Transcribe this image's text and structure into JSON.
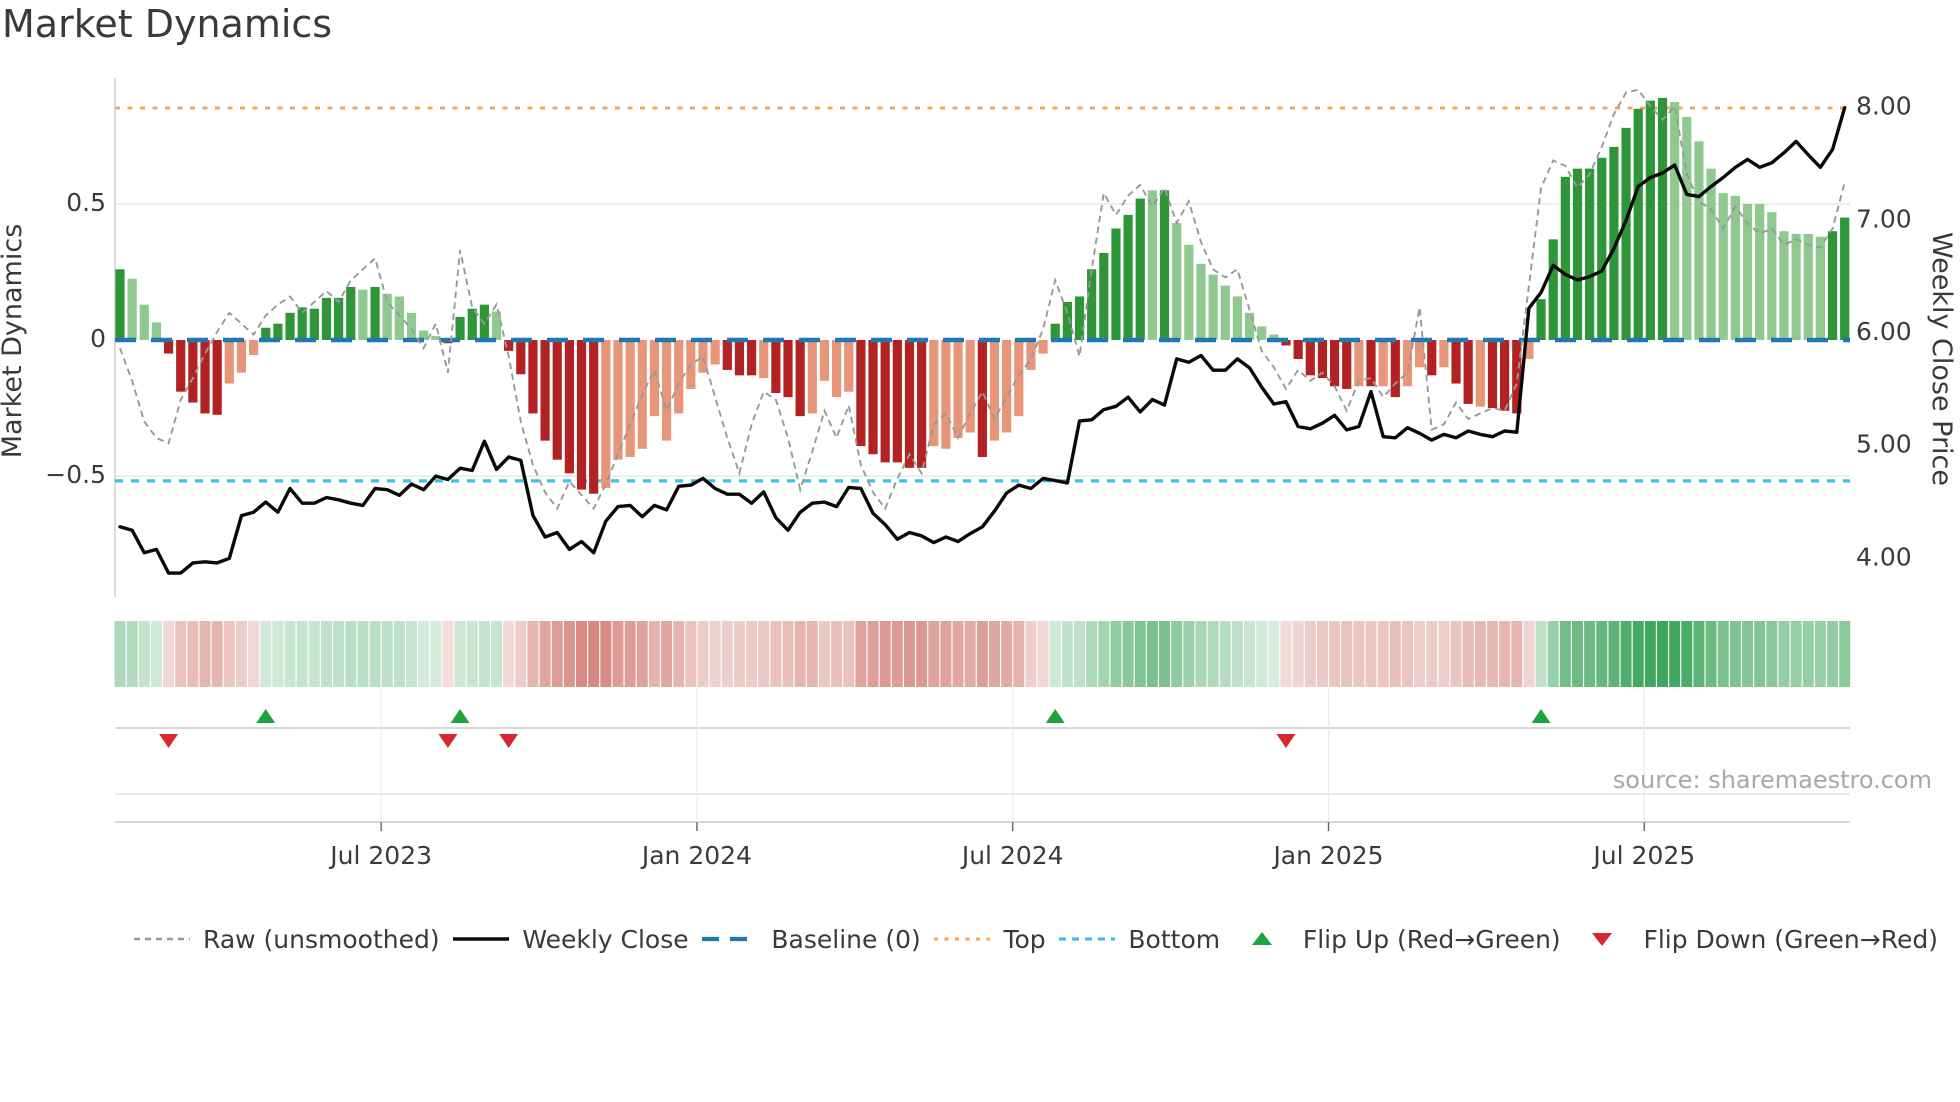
{
  "title": "Market Dynamics",
  "source_text": "source: sharemaestro.com",
  "axes": {
    "left_label": "Market Dynamics",
    "right_label": "Weekly Close Price",
    "left_ticks": [
      {
        "v": 0.5,
        "label": "0.5"
      },
      {
        "v": 0.0,
        "label": "0"
      },
      {
        "v": -0.5,
        "label": "−0.5"
      }
    ],
    "right_ticks": [
      {
        "v": 8.0,
        "label": "8.00"
      },
      {
        "v": 7.0,
        "label": "7.00"
      },
      {
        "v": 6.0,
        "label": "6.00"
      },
      {
        "v": 5.0,
        "label": "5.00"
      },
      {
        "v": 4.0,
        "label": "4.00"
      }
    ],
    "x_ticks": [
      {
        "week": 21.5,
        "label": "Jul 2023"
      },
      {
        "week": 47.5,
        "label": "Jan 2024"
      },
      {
        "week": 73.5,
        "label": "Jul 2024"
      },
      {
        "week": 99.5,
        "label": "Jan 2025"
      },
      {
        "week": 125.5,
        "label": "Jul 2025"
      }
    ]
  },
  "legend": [
    {
      "id": "raw",
      "type": "dash-gray",
      "label": "Raw (unsmoothed)"
    },
    {
      "id": "close",
      "type": "solid-black",
      "label": "Weekly Close"
    },
    {
      "id": "baseline",
      "type": "dash-blue",
      "label": "Baseline (0)"
    },
    {
      "id": "top",
      "type": "dot-orange",
      "label": "Top"
    },
    {
      "id": "bottom",
      "type": "dash-cyan",
      "label": "Bottom"
    },
    {
      "id": "flip-up",
      "type": "triangle-up",
      "label": "Flip Up (Red→Green)"
    },
    {
      "id": "flip-down",
      "type": "triangle-down",
      "label": "Flip Down (Green→Red)"
    }
  ],
  "colors": {
    "strong_green": "#2e9639",
    "weak_green": "#8fc990",
    "strong_red": "#b22222",
    "weak_red": "#e8967a",
    "price_line": "#0a0a0a",
    "raw_line": "#999999",
    "baseline": "#1f77b4",
    "top_line": "#f2a663",
    "bottom_line": "#3ec0ea",
    "grid": "#e9e9e9",
    "spine": "#d0d0d0",
    "panel_line": "#cccccc",
    "axis_bottom": "#c8c8c8",
    "tick_text": "#3b3b3b",
    "flip_up": "#1fa33c",
    "flip_down": "#d7282f",
    "heat_green_base": [
      47,
      158,
      79
    ],
    "heat_red_base": [
      192,
      74,
      62
    ]
  },
  "chart_data": {
    "type": "bar",
    "n_weeks": 143,
    "baseline": 0,
    "top_line_value": 0.853,
    "bottom_line_value": -0.518,
    "ylim_left": [
      -0.95,
      0.963
    ],
    "ylim_right": [
      3.66,
      8.26
    ],
    "legend_position": "bottom",
    "grid": "horizontal-light",
    "flip_up_weeks": [
      12,
      28,
      77,
      117
    ],
    "flip_down_weeks": [
      4,
      27,
      32,
      96
    ],
    "osc_values": [
      0.26,
      0.225,
      0.13,
      0.065,
      -0.05,
      -0.19,
      -0.23,
      -0.27,
      -0.275,
      -0.16,
      -0.12,
      -0.055,
      0.045,
      0.06,
      0.1,
      0.12,
      0.115,
      0.155,
      0.155,
      0.195,
      0.185,
      0.195,
      0.17,
      0.16,
      0.1,
      0.035,
      0.015,
      -0.012,
      0.085,
      0.115,
      0.13,
      0.105,
      -0.04,
      -0.126,
      -0.27,
      -0.37,
      -0.44,
      -0.49,
      -0.55,
      -0.565,
      -0.545,
      -0.44,
      -0.43,
      -0.4,
      -0.28,
      -0.37,
      -0.27,
      -0.18,
      -0.12,
      -0.09,
      -0.11,
      -0.13,
      -0.13,
      -0.14,
      -0.195,
      -0.21,
      -0.28,
      -0.27,
      -0.15,
      -0.21,
      -0.19,
      -0.39,
      -0.42,
      -0.45,
      -0.45,
      -0.47,
      -0.47,
      -0.39,
      -0.4,
      -0.36,
      -0.34,
      -0.43,
      -0.37,
      -0.34,
      -0.28,
      -0.11,
      -0.05,
      0.06,
      0.14,
      0.16,
      0.26,
      0.32,
      0.41,
      0.46,
      0.52,
      0.55,
      0.55,
      0.43,
      0.35,
      0.28,
      0.24,
      0.2,
      0.16,
      0.1,
      0.05,
      0.02,
      -0.02,
      -0.07,
      -0.13,
      -0.14,
      -0.17,
      -0.18,
      -0.17,
      -0.17,
      -0.17,
      -0.21,
      -0.17,
      -0.1,
      -0.13,
      -0.1,
      -0.16,
      -0.235,
      -0.245,
      -0.25,
      -0.26,
      -0.27,
      -0.07,
      0.15,
      0.37,
      0.6,
      0.63,
      0.63,
      0.67,
      0.71,
      0.78,
      0.85,
      0.88,
      0.89,
      0.875,
      0.82,
      0.73,
      0.63,
      0.54,
      0.53,
      0.5,
      0.5,
      0.47,
      0.4,
      0.39,
      0.39,
      0.38,
      0.4,
      0.45
    ],
    "osc_strong": [
      1,
      0,
      0,
      0,
      1,
      1,
      1,
      1,
      1,
      0,
      0,
      0,
      1,
      1,
      1,
      1,
      1,
      1,
      1,
      1,
      0,
      1,
      0,
      0,
      0,
      0,
      0,
      1,
      1,
      1,
      1,
      0,
      1,
      1,
      1,
      1,
      1,
      1,
      1,
      1,
      0,
      0,
      0,
      0,
      0,
      0,
      0,
      0,
      0,
      0,
      1,
      1,
      1,
      0,
      1,
      1,
      1,
      0,
      0,
      0,
      0,
      1,
      1,
      1,
      1,
      1,
      1,
      0,
      0,
      0,
      0,
      1,
      0,
      0,
      0,
      0,
      0,
      1,
      1,
      1,
      1,
      1,
      1,
      1,
      1,
      0,
      1,
      0,
      0,
      0,
      0,
      0,
      0,
      0,
      0,
      0,
      1,
      1,
      1,
      1,
      1,
      1,
      0,
      1,
      0,
      1,
      0,
      0,
      1,
      0,
      1,
      1,
      0,
      1,
      1,
      1,
      0,
      1,
      1,
      1,
      1,
      1,
      1,
      1,
      1,
      1,
      1,
      1,
      0,
      0,
      0,
      0,
      0,
      0,
      0,
      0,
      0,
      0,
      0,
      0,
      0,
      1,
      1
    ],
    "raw_values": [
      -0.03,
      -0.15,
      -0.3,
      -0.36,
      -0.38,
      -0.22,
      -0.14,
      -0.05,
      0.03,
      0.1,
      0.06,
      0.02,
      0.09,
      0.13,
      0.16,
      0.1,
      0.14,
      0.18,
      0.14,
      0.22,
      0.26,
      0.3,
      0.14,
      0.09,
      0.04,
      -0.03,
      0.06,
      -0.12,
      0.33,
      0.12,
      0.06,
      0.13,
      -0.06,
      -0.3,
      -0.46,
      -0.56,
      -0.62,
      -0.52,
      -0.57,
      -0.62,
      -0.53,
      -0.42,
      -0.31,
      -0.2,
      -0.11,
      -0.26,
      -0.16,
      -0.09,
      -0.06,
      -0.21,
      -0.36,
      -0.49,
      -0.31,
      -0.19,
      -0.22,
      -0.36,
      -0.55,
      -0.41,
      -0.26,
      -0.36,
      -0.24,
      -0.46,
      -0.56,
      -0.62,
      -0.51,
      -0.42,
      -0.49,
      -0.31,
      -0.27,
      -0.36,
      -0.27,
      -0.19,
      -0.29,
      -0.21,
      -0.13,
      -0.07,
      0.04,
      0.22,
      0.1,
      -0.06,
      0.26,
      0.54,
      0.46,
      0.53,
      0.57,
      0.49,
      0.56,
      0.43,
      0.51,
      0.36,
      0.26,
      0.23,
      0.26,
      0.11,
      -0.04,
      -0.1,
      -0.18,
      -0.11,
      -0.15,
      -0.12,
      -0.17,
      -0.26,
      -0.15,
      -0.14,
      -0.21,
      -0.16,
      -0.12,
      0.12,
      -0.33,
      -0.31,
      -0.23,
      -0.29,
      -0.27,
      -0.25,
      -0.26,
      -0.16,
      0.2,
      0.56,
      0.66,
      0.64,
      0.56,
      0.61,
      0.71,
      0.83,
      0.91,
      0.92,
      0.86,
      0.81,
      0.86,
      0.61,
      0.51,
      0.48,
      0.41,
      0.49,
      0.43,
      0.39,
      0.41,
      0.35,
      0.37,
      0.35,
      0.34,
      0.41,
      0.58
    ],
    "price_values": [
      4.28,
      4.25,
      4.05,
      4.08,
      3.87,
      3.87,
      3.96,
      3.97,
      3.96,
      4.0,
      4.38,
      4.41,
      4.5,
      4.41,
      4.62,
      4.49,
      4.49,
      4.54,
      4.52,
      4.49,
      4.47,
      4.62,
      4.61,
      4.56,
      4.66,
      4.61,
      4.73,
      4.7,
      4.8,
      4.78,
      5.04,
      4.79,
      4.9,
      4.87,
      4.38,
      4.19,
      4.23,
      4.08,
      4.15,
      4.05,
      4.33,
      4.46,
      4.47,
      4.37,
      4.47,
      4.43,
      4.64,
      4.65,
      4.71,
      4.62,
      4.57,
      4.57,
      4.49,
      4.59,
      4.36,
      4.25,
      4.41,
      4.49,
      4.5,
      4.46,
      4.63,
      4.62,
      4.4,
      4.3,
      4.17,
      4.23,
      4.2,
      4.14,
      4.19,
      4.15,
      4.22,
      4.28,
      4.42,
      4.58,
      4.65,
      4.62,
      4.71,
      4.69,
      4.67,
      5.22,
      5.23,
      5.32,
      5.35,
      5.43,
      5.3,
      5.41,
      5.36,
      5.77,
      5.74,
      5.8,
      5.67,
      5.67,
      5.77,
      5.69,
      5.52,
      5.37,
      5.39,
      5.17,
      5.15,
      5.2,
      5.27,
      5.14,
      5.17,
      5.48,
      5.08,
      5.07,
      5.16,
      5.11,
      5.05,
      5.1,
      5.07,
      5.13,
      5.1,
      5.08,
      5.13,
      5.12,
      6.22,
      6.36,
      6.6,
      6.52,
      6.47,
      6.5,
      6.55,
      6.75,
      7.0,
      7.3,
      7.38,
      7.42,
      7.49,
      7.23,
      7.21,
      7.3,
      7.38,
      7.47,
      7.54,
      7.47,
      7.51,
      7.6,
      7.7,
      7.58,
      7.47,
      7.63,
      8.0
    ]
  }
}
